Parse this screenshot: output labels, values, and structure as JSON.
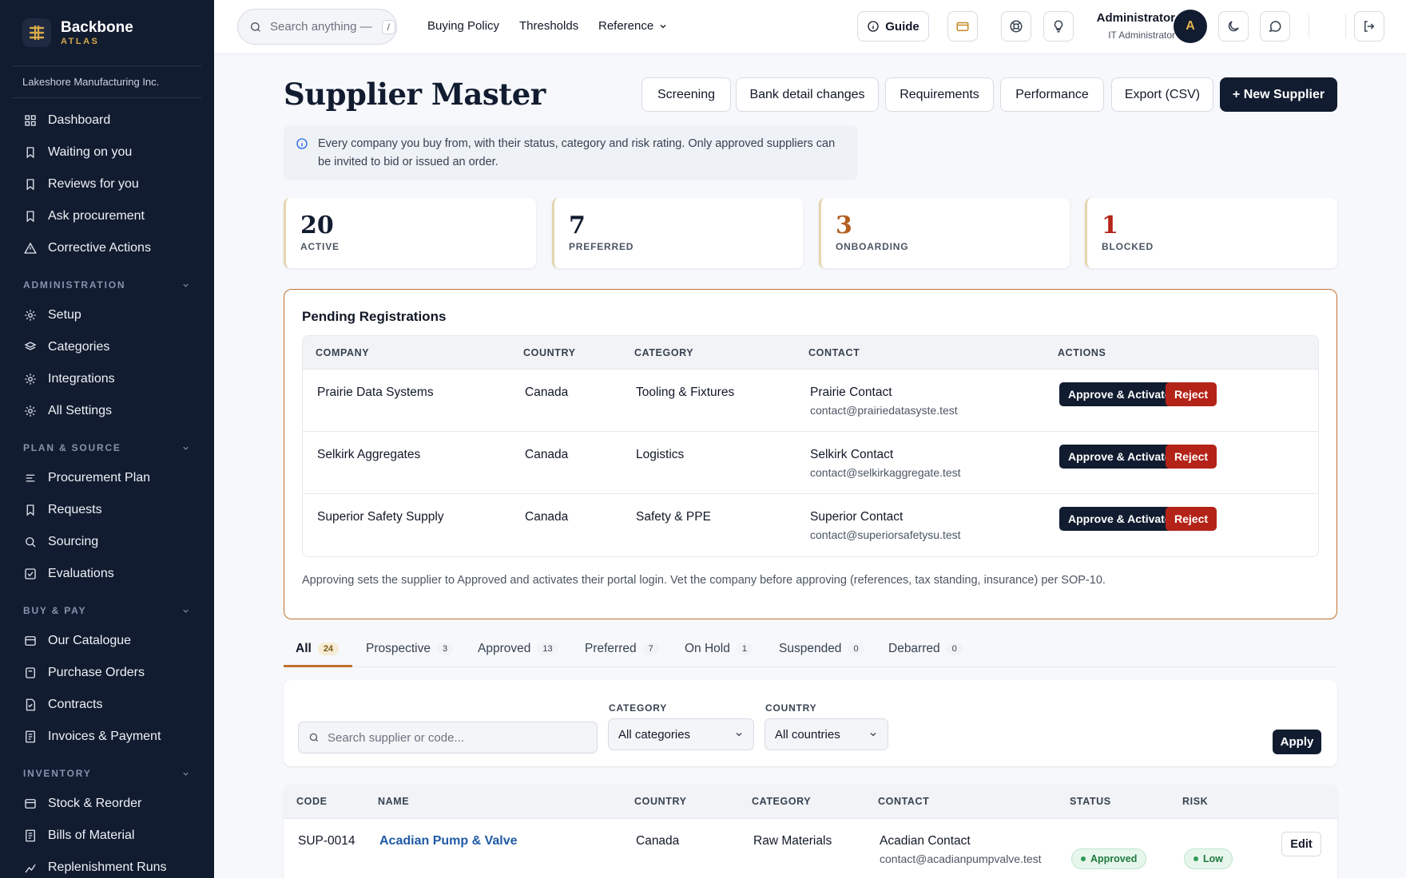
{
  "brand": {
    "name": "Backbone",
    "sub": "ATLAS",
    "org": "Lakeshore Manufacturing Inc."
  },
  "sidebar": {
    "top": [
      {
        "label": "Dashboard",
        "icon": "grid-icon"
      },
      {
        "label": "Waiting on you",
        "icon": "bookmark-icon"
      },
      {
        "label": "Reviews for you",
        "icon": "bookmark-icon"
      },
      {
        "label": "Ask procurement",
        "icon": "bookmark-icon"
      },
      {
        "label": "Corrective Actions",
        "icon": "warning-icon"
      }
    ],
    "sections": [
      {
        "title": "ADMINISTRATION",
        "items": [
          {
            "label": "Setup",
            "icon": "gear-icon"
          },
          {
            "label": "Categories",
            "icon": "layers-icon"
          },
          {
            "label": "Integrations",
            "icon": "gear-icon"
          },
          {
            "label": "All Settings",
            "icon": "gear-icon"
          }
        ]
      },
      {
        "title": "PLAN & SOURCE",
        "items": [
          {
            "label": "Procurement Plan",
            "icon": "list-icon"
          },
          {
            "label": "Requests",
            "icon": "bookmark-icon"
          },
          {
            "label": "Sourcing",
            "icon": "search-icon"
          },
          {
            "label": "Evaluations",
            "icon": "checkbox-icon"
          }
        ]
      },
      {
        "title": "BUY & PAY",
        "items": [
          {
            "label": "Our Catalogue",
            "icon": "card-icon"
          },
          {
            "label": "Purchase Orders",
            "icon": "box-icon"
          },
          {
            "label": "Contracts",
            "icon": "document-icon"
          },
          {
            "label": "Invoices & Payment",
            "icon": "receipt-icon"
          }
        ]
      },
      {
        "title": "INVENTORY",
        "items": [
          {
            "label": "Stock & Reorder",
            "icon": "card-icon"
          },
          {
            "label": "Bills of Material",
            "icon": "receipt-icon"
          },
          {
            "label": "Replenishment Runs",
            "icon": "chart-icon"
          }
        ]
      }
    ]
  },
  "topbar": {
    "search_placeholder": "Search anything —",
    "search_kbd": "/",
    "links": [
      "Buying Policy",
      "Thresholds",
      "Reference"
    ],
    "guide": "Guide",
    "user_name": "Administrator",
    "user_role": "IT Administrator",
    "avatar": "A"
  },
  "page": {
    "title": "Supplier Master",
    "buttons": [
      "Screening",
      "Bank detail changes",
      "Requirements",
      "Performance",
      "Export (CSV)",
      "+ New Supplier"
    ],
    "info": "Every company you buy from, with their status, category and risk rating. Only approved suppliers can be invited to bid or issued an order."
  },
  "stats": [
    {
      "value": "20",
      "label": "ACTIVE",
      "color": "#121c30"
    },
    {
      "value": "7",
      "label": "PREFERRED",
      "color": "#121c30"
    },
    {
      "value": "3",
      "label": "ONBOARDING",
      "color": "#b45f1f"
    },
    {
      "value": "1",
      "label": "BLOCKED",
      "color": "#b42318"
    }
  ],
  "pending": {
    "title": "Pending Registrations",
    "headers": [
      "COMPANY",
      "COUNTRY",
      "CATEGORY",
      "CONTACT",
      "ACTIONS"
    ],
    "rows": [
      {
        "company": "Prairie Data Systems",
        "country": "Canada",
        "category": "Tooling & Fixtures",
        "contact": "Prairie Contact",
        "email": "contact@prairiedatasyste.test"
      },
      {
        "company": "Selkirk Aggregates",
        "country": "Canada",
        "category": "Logistics",
        "contact": "Selkirk Contact",
        "email": "contact@selkirkaggregate.test"
      },
      {
        "company": "Superior Safety Supply",
        "country": "Canada",
        "category": "Safety & PPE",
        "contact": "Superior Contact",
        "email": "contact@superiorsafetysu.test"
      }
    ],
    "approve_label": "Approve & Activate",
    "reject_label": "Reject",
    "note": "Approving sets the supplier to Approved and activates their portal login. Vet the company before approving (references, tax standing, insurance) per SOP-10."
  },
  "tabs": [
    {
      "label": "All",
      "count": "24"
    },
    {
      "label": "Prospective",
      "count": "3"
    },
    {
      "label": "Approved",
      "count": "13"
    },
    {
      "label": "Preferred",
      "count": "7"
    },
    {
      "label": "On Hold",
      "count": "1"
    },
    {
      "label": "Suspended",
      "count": "0"
    },
    {
      "label": "Debarred",
      "count": "0"
    }
  ],
  "filters": {
    "search_placeholder": "Search supplier or code...",
    "category_label": "CATEGORY",
    "category_value": "All categories",
    "country_label": "COUNTRY",
    "country_value": "All countries",
    "apply": "Apply"
  },
  "suppliers": {
    "headers": [
      "CODE",
      "NAME",
      "COUNTRY",
      "CATEGORY",
      "CONTACT",
      "STATUS",
      "RISK"
    ],
    "rows": [
      {
        "code": "SUP-0014",
        "name": "Acadian Pump & Valve",
        "country": "Canada",
        "category": "Raw Materials",
        "contact": "Acadian Contact",
        "email": "contact@acadianpumpvalve.test",
        "status": "Approved",
        "risk": "Low"
      }
    ],
    "edit_label": "Edit"
  }
}
